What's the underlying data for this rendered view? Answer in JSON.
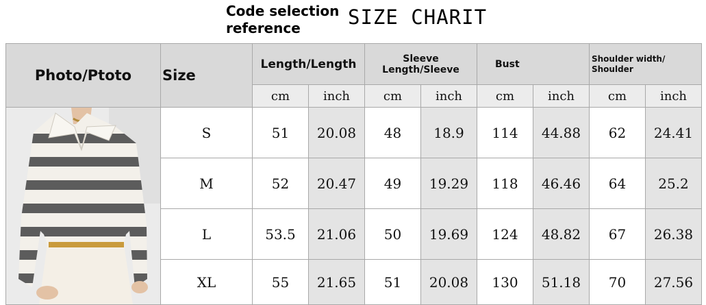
{
  "header": {
    "note": [
      "Code selection",
      "reference"
    ],
    "title": "SIZE CHARIT"
  },
  "table": {
    "photo_header": "Photo/Ptoto",
    "size_header": "Size",
    "groups": [
      {
        "label": "Length/Length",
        "units": [
          "cm",
          "inch"
        ]
      },
      {
        "label": "Sleeve Length/Sleeve",
        "units": [
          "cm",
          "inch"
        ]
      },
      {
        "label": "Bust",
        "units": [
          "cm",
          "inch"
        ]
      },
      {
        "label": "Shoulder width/ Shoulder",
        "units": [
          "cm",
          "inch"
        ]
      }
    ],
    "rows": [
      {
        "size": "S",
        "values": [
          "51",
          "20.08",
          "48",
          "18.9",
          "114",
          "44.88",
          "62",
          "24.41"
        ]
      },
      {
        "size": "M",
        "values": [
          "52",
          "20.47",
          "49",
          "19.29",
          "118",
          "46.46",
          "64",
          "25.2"
        ]
      },
      {
        "size": "L",
        "values": [
          "53.5",
          "21.06",
          "50",
          "19.69",
          "124",
          "48.82",
          "67",
          "26.38"
        ]
      },
      {
        "size": "XL",
        "values": [
          "55",
          "21.65",
          "51",
          "20.08",
          "130",
          "51.18",
          "70",
          "27.56"
        ]
      }
    ]
  },
  "colors": {
    "header_bg": "#d9d9d9",
    "stripe_gray": "#e4e4e4",
    "sweater_stripe": "#5c5c5c",
    "sweater_base": "#f3f0ea"
  }
}
